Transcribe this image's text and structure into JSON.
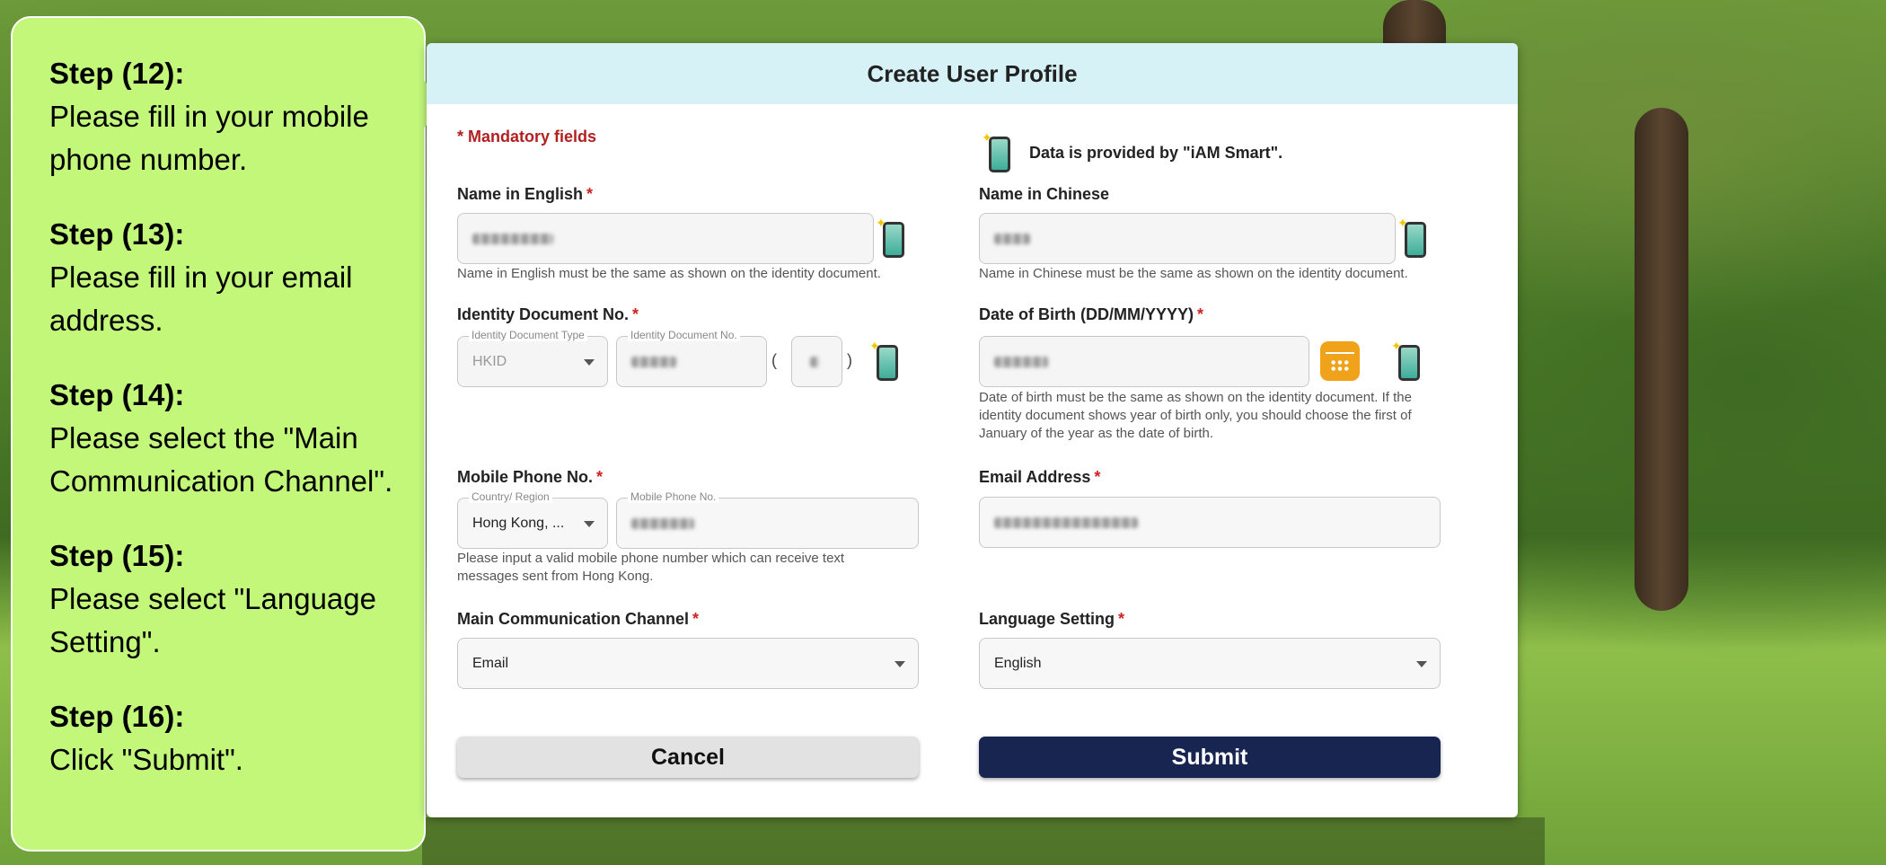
{
  "callout": {
    "steps": [
      {
        "title": "Step (12):",
        "text": "Please fill in your mobile phone number."
      },
      {
        "title": "Step (13):",
        "text": "Please fill in your email address."
      },
      {
        "title": "Step (14):",
        "text": "Please select the \"Main Communication Channel\"."
      },
      {
        "title": "Step (15):",
        "text": "Please select \"Language Setting\"."
      },
      {
        "title": "Step (16):",
        "text": "Click \"Submit\"."
      }
    ]
  },
  "dialog": {
    "title": "Create User Profile",
    "mandatory_note": "* Mandatory fields",
    "iam_note": "Data is provided by \"iAM Smart\".",
    "name_en": {
      "label": "Name in English",
      "required": "*",
      "hint": "Name in English must be the same as shown on the identity document."
    },
    "name_zh": {
      "label": "Name in Chinese",
      "hint": "Name in Chinese must be the same as shown on the identity document."
    },
    "id_doc": {
      "label": "Identity Document No.",
      "required": "*",
      "type_label": "Identity Document Type",
      "type_value": "HKID",
      "no_label": "Identity Document No.",
      "paren_open": "(",
      "paren_close": ")"
    },
    "dob": {
      "label": "Date of Birth (DD/MM/YYYY)",
      "required": "*",
      "hint": "Date of birth must be the same as shown on the identity document. If the identity document shows year of birth only, you should choose the first of January of the year as the date of birth."
    },
    "mobile": {
      "label": "Mobile Phone No.",
      "required": "*",
      "region_label": "Country/ Region",
      "region_value": "Hong Kong, ...",
      "no_label": "Mobile Phone No.",
      "hint": "Please input a valid mobile phone number which can receive text messages sent from Hong Kong."
    },
    "email": {
      "label": "Email Address",
      "required": "*"
    },
    "channel": {
      "label": "Main Communication Channel",
      "required": "*",
      "value": "Email"
    },
    "language": {
      "label": "Language Setting",
      "required": "*",
      "value": "English"
    },
    "cancel_label": "Cancel",
    "submit_label": "Submit"
  },
  "icons": {
    "iam_smart": "iam-smart-icon",
    "calendar": "calendar-icon",
    "dropdown": "chevron-down-icon"
  },
  "colors": {
    "callout_bg": "#c2f77a",
    "header_bg": "#d7f2f6",
    "submit_bg": "#182551",
    "required": "#cc2222"
  }
}
